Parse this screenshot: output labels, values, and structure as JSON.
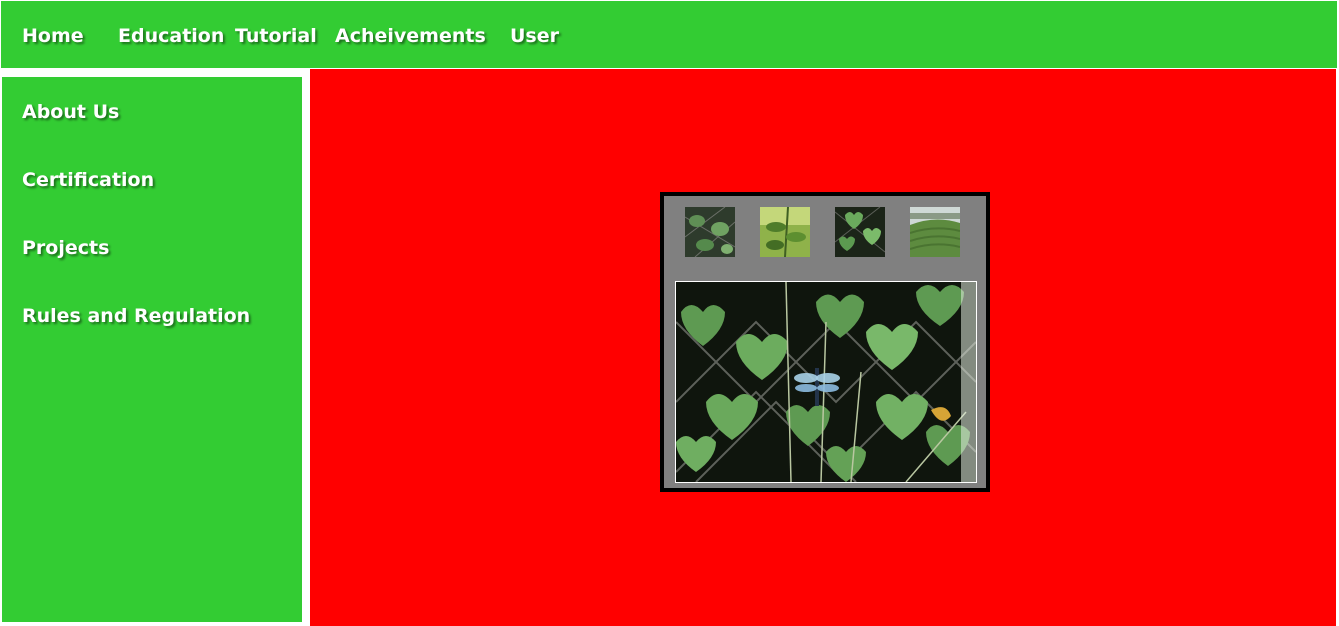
{
  "topnav": {
    "items": [
      {
        "label": "Home"
      },
      {
        "label": "Education"
      },
      {
        "label": "Tutorial"
      },
      {
        "label": "Acheivements"
      },
      {
        "label": "User"
      }
    ]
  },
  "sidebar": {
    "items": [
      {
        "label": "About Us"
      },
      {
        "label": "Certification"
      },
      {
        "label": "Projects"
      },
      {
        "label": "Rules and Regulation"
      }
    ]
  },
  "colors": {
    "nav_green": "#33cc33",
    "content_red": "#ff0000",
    "gallery_gray": "#808080",
    "gallery_border": "#000000",
    "text": "#ffffff"
  },
  "gallery": {
    "thumbnails": [
      {
        "subject": "leaves-on-fence-photo"
      },
      {
        "subject": "green-plant-photo"
      },
      {
        "subject": "heart-leaves-photo"
      },
      {
        "subject": "hillside-field-photo"
      }
    ],
    "main_photo": {
      "subject": "dragonfly-on-leaves-photo"
    }
  }
}
